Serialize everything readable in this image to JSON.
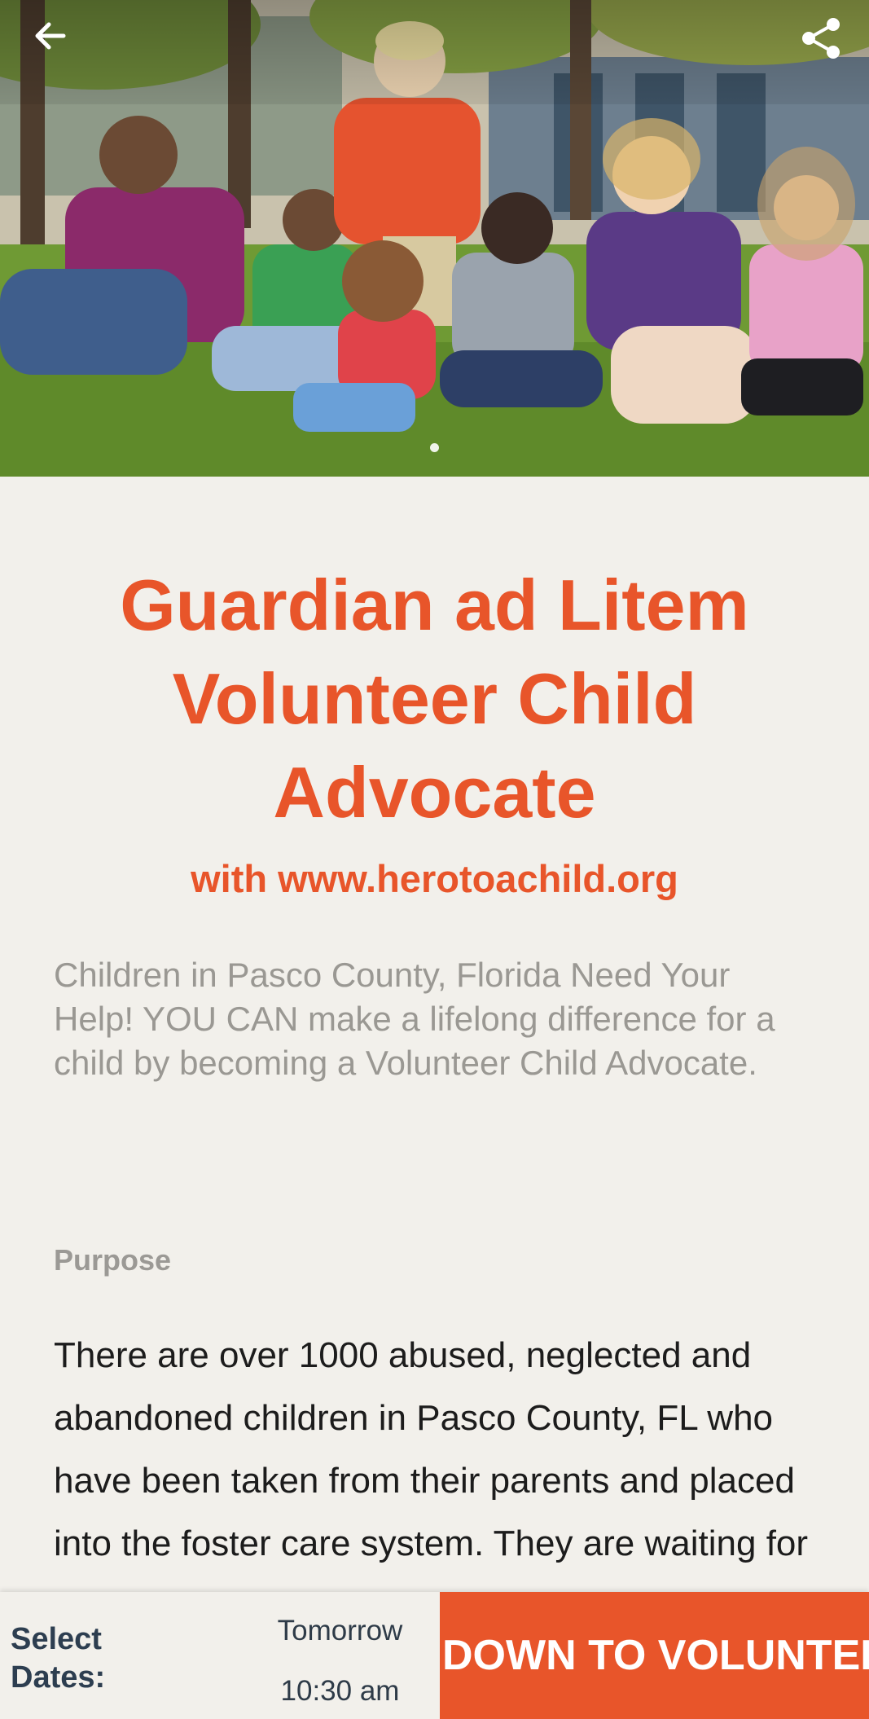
{
  "hero": {
    "image_alt": "Group of children sitting on grass in a park",
    "back_icon": "arrow-left-icon",
    "share_icon": "share-icon",
    "carousel_index": 1,
    "carousel_total": 1
  },
  "opportunity": {
    "title": "Guardian ad Litem Volunteer Child Advocate",
    "organization": "with www.herotoachild.org",
    "summary": "Children in Pasco County, Florida Need Your Help! YOU CAN make a lifelong difference for a child by becoming a Volunteer Child Advocate.",
    "purpose_label": "Purpose",
    "purpose_text": "There are over 1000 abused, neglected and abandoned children in Pasco County, FL who have been taken from their parents and placed into the foster care system. They are waiting for someone to be their voice."
  },
  "bottom_bar": {
    "select_label": "Select Dates:",
    "date": "Tomorrow",
    "time": "10:30 am",
    "cta_label": "DOWN TO VOLUNTEER"
  },
  "colors": {
    "accent": "#e8552a",
    "background": "#f2f0eb",
    "muted_text": "#9a9893",
    "dark_text": "#2d3e50"
  }
}
